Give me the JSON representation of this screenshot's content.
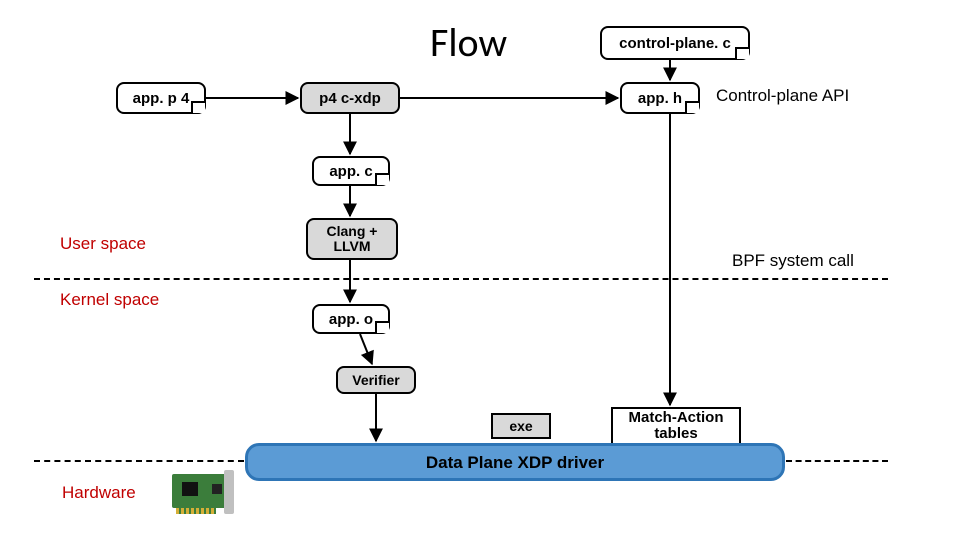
{
  "title": "Flow",
  "nodes": {
    "app_p4": "app. p 4",
    "p4c_xdp": "p4 c-xdp",
    "control_plane_c": "control-plane. c",
    "app_h": "app. h",
    "app_c": "app. c",
    "clang_llvm": "Clang + LLVM",
    "app_o": "app. o",
    "verifier": "Verifier",
    "exe": "exe",
    "match_action": "Match-Action tables",
    "driver": "Data Plane XDP driver"
  },
  "labels": {
    "control_plane_api": "Control-plane API",
    "user_space": "User space",
    "kernel_space": "Kernel space",
    "bpf_syscall": "BPF system call",
    "hardware": "Hardware"
  }
}
